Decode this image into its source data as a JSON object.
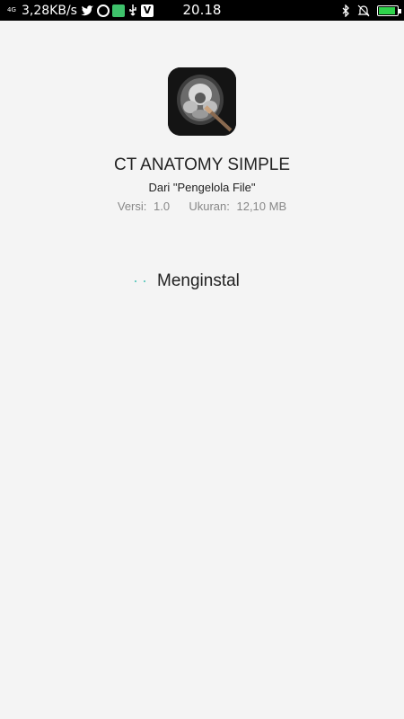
{
  "status_bar": {
    "signal_text": "4G",
    "network_speed": "3,28KB/s",
    "time": "20.18",
    "battery_color": "#2fd34b"
  },
  "app": {
    "name": "CT ANATOMY SIMPLE",
    "source": "Dari \"Pengelola File\"",
    "version_label": "Versi:",
    "version_value": "1.0",
    "size_label": "Ukuran:",
    "size_value": "12,10 MB",
    "icon": "ct-scan-icon"
  },
  "install": {
    "status": "Menginstal",
    "accent": "#3dbfb0"
  }
}
